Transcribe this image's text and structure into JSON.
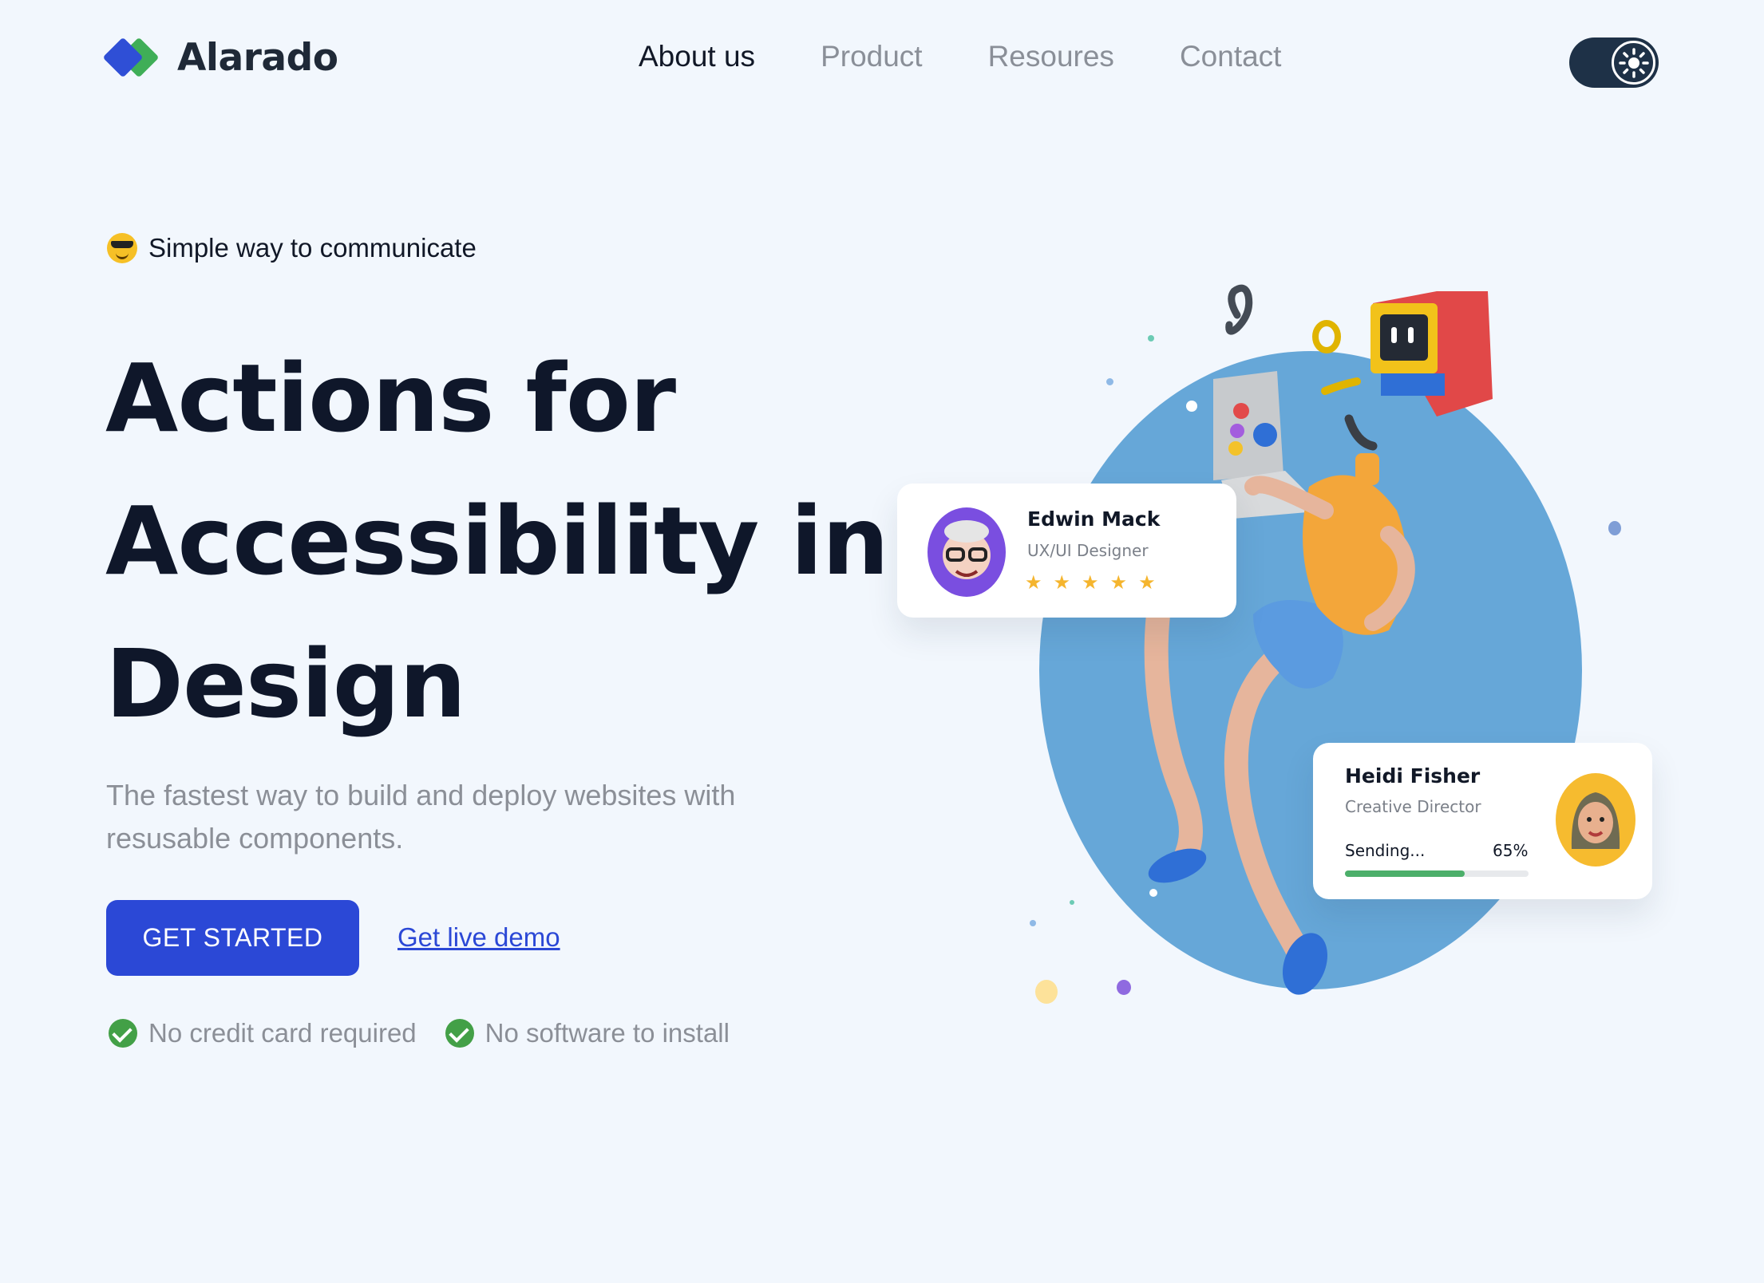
{
  "brand": {
    "name": "Alarado",
    "logo_icon": "diamond-logo-icon",
    "colors": [
      "#2f4fd6",
      "#3fae57"
    ]
  },
  "nav": [
    {
      "label": "About us",
      "active": true
    },
    {
      "label": "Product",
      "active": false
    },
    {
      "label": "Resoures",
      "active": false
    },
    {
      "label": "Contact",
      "active": false
    }
  ],
  "theme_toggle": {
    "icon": "sun-icon"
  },
  "hero": {
    "tagline": "Simple way to communicate",
    "tagline_icon": "sunglasses-emoji-icon",
    "headline_lines": [
      "Actions for",
      "Accessibility in",
      "Design"
    ],
    "subtitle": "The fastest way to build and deploy websites with resusable components.",
    "cta_primary": "GET STARTED",
    "cta_secondary": "Get live demo",
    "checks": [
      "No credit card required",
      "No software to install"
    ],
    "accent_color": "#2b48d6"
  },
  "cards": {
    "edwin": {
      "name": "Edwin Mack",
      "role": "UX/UI Designer",
      "rating": 5
    },
    "heidi": {
      "name": "Heidi Fisher",
      "role": "Creative Director",
      "status": "Sending...",
      "progress_label": "65%",
      "progress": 0.65
    }
  }
}
